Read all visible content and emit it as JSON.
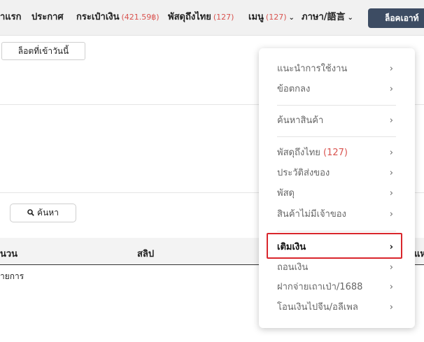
{
  "nav": {
    "home": "ำแรก",
    "announce": "ประกาศ",
    "wallet_label": "กระเป๋าเงิน",
    "wallet_balance": "(421.59฿)",
    "parcel_label": "พัสดุถึงไทย",
    "parcel_count": "(127)",
    "menu_label": "เมนู",
    "menu_count": "(127)",
    "language_label": "ภาษา/語言",
    "logout_label": "ล็อคเอาท์"
  },
  "page": {
    "today_login_btn": "ล็อตที่เข้าวันนี้",
    "search_btn": "ค้นหา",
    "table_headers": [
      "นวน",
      "สลิป",
      "แห"
    ],
    "row_text": "ายการ"
  },
  "dropdown": {
    "items": [
      {
        "label": "แนะนำการใช้งาน"
      },
      {
        "label": "ข้อตกลง"
      },
      {
        "label": "ค้นหาสินค้า"
      },
      {
        "label": "พัสดุถึงไทย",
        "count": "(127)"
      },
      {
        "label": "ประวัติส่งของ"
      },
      {
        "label": "พัสดุ"
      },
      {
        "label": "สินค้าไม่มีเจ้าของ"
      },
      {
        "label": "เติมเงิน"
      },
      {
        "label": "ถอนเงิน"
      },
      {
        "label": "ฝากจ่ายเถาเป่า/1688"
      },
      {
        "label": "โอนเงินไปจีน/อลีเพล"
      }
    ]
  },
  "colors": {
    "accent_red": "#d9262c",
    "count_red": "#d9534f",
    "logout_bg": "#3d4c63"
  }
}
